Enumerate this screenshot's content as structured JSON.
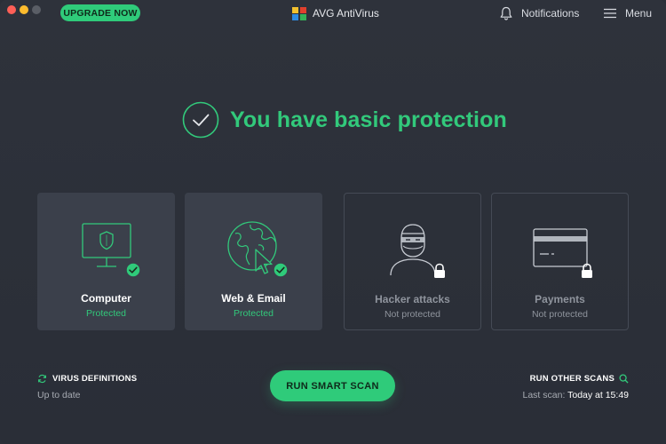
{
  "titlebar": {
    "upgrade_label": "UPGRADE NOW",
    "app_title": "AVG AntiVirus",
    "notifications_label": "Notifications",
    "menu_label": "Menu"
  },
  "headline": {
    "text": "You have basic protection"
  },
  "cards": [
    {
      "label": "Computer",
      "status": "Protected",
      "icon": "monitor-shield-icon",
      "protected": true
    },
    {
      "label": "Web & Email",
      "status": "Protected",
      "icon": "globe-cursor-icon",
      "protected": true
    },
    {
      "label": "Hacker attacks",
      "status": "Not protected",
      "icon": "hacker-icon",
      "protected": false
    },
    {
      "label": "Payments",
      "status": "Not protected",
      "icon": "credit-card-icon",
      "protected": false
    }
  ],
  "footer": {
    "virus_definitions_title": "VIRUS DEFINITIONS",
    "virus_definitions_status": "Up to date",
    "scan_button_label": "RUN SMART SCAN",
    "other_scans_title": "RUN OTHER SCANS",
    "last_scan_prefix": "Last scan:",
    "last_scan_time": "Today at 15:49"
  },
  "colors": {
    "accent": "#2fcb7a",
    "background": "#2b2f38",
    "card_active": "#3b404b",
    "muted_text": "#8f949d"
  }
}
